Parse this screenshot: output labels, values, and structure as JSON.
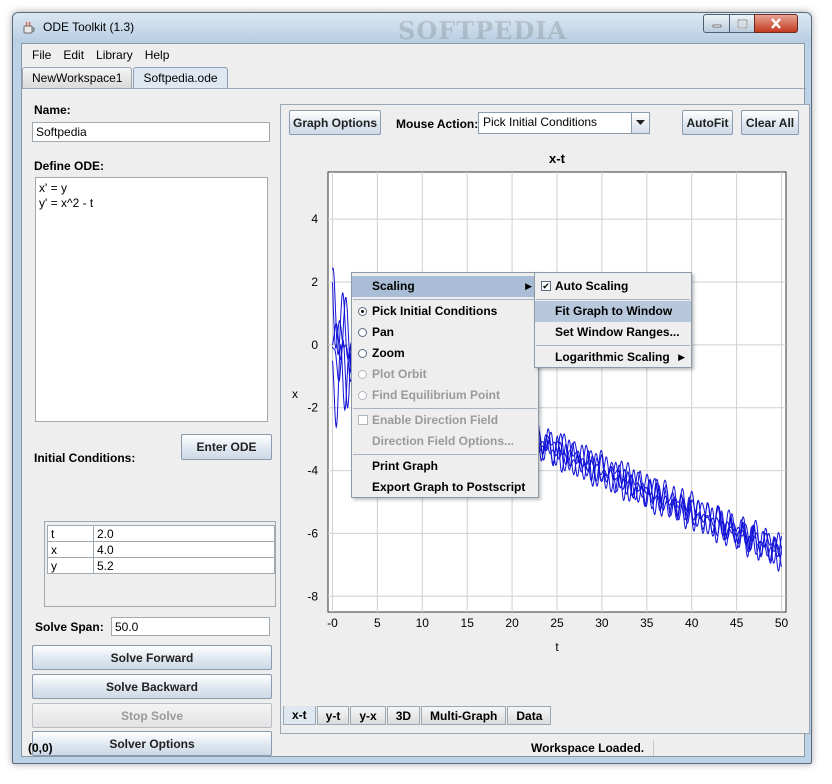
{
  "window": {
    "title": "ODE Toolkit (1.3)",
    "watermark": "SOFTPEDIA"
  },
  "menubar": {
    "items": [
      "File",
      "Edit",
      "Library",
      "Help"
    ]
  },
  "workspace_tabs": [
    "NewWorkspace1",
    "Softpedia.ode"
  ],
  "left_panel": {
    "name_label": "Name:",
    "name_value": "Softpedia",
    "define_label": "Define ODE:",
    "ode_line1": "x' = y",
    "ode_line2": "y' = x^2 - t",
    "ic_label": "Initial Conditions:",
    "enter_ode": "Enter ODE",
    "ic_rows": [
      {
        "var": "t",
        "val": "2.0"
      },
      {
        "var": "x",
        "val": "4.0"
      },
      {
        "var": "y",
        "val": "5.2"
      }
    ],
    "span_label": "Solve Span:",
    "span_value": "50.0",
    "solve_forward": "Solve Forward",
    "solve_backward": "Solve Backward",
    "stop_solve": "Stop Solve",
    "solver_options": "Solver Options"
  },
  "graph_toolbar": {
    "graph_options": "Graph Options",
    "mouse_action_label": "Mouse Action:",
    "mouse_action_value": "Pick Initial Conditions",
    "autofit": "AutoFit",
    "clear_all": "Clear All"
  },
  "chart_data": {
    "type": "line",
    "title": "x-t",
    "xlabel": "t",
    "ylabel": "x",
    "xlim": [
      -0.5,
      50.5
    ],
    "ylim": [
      -8.5,
      5.5
    ],
    "x_ticks": [
      "-0",
      "5",
      "10",
      "15",
      "20",
      "25",
      "30",
      "35",
      "40",
      "45",
      "50"
    ],
    "y_ticks": [
      "4",
      "2",
      "0",
      "-2",
      "-4",
      "-6",
      "-8"
    ],
    "grid": true,
    "line_color": "#1010d8",
    "series_count": 5,
    "description_of_trend": "oscillating curves descending from about 0 near t=0 to about -6.5 at t=50"
  },
  "graph_tabs": [
    "x-t",
    "y-t",
    "y-x",
    "3D",
    "Multi-Graph",
    "Data"
  ],
  "status": {
    "coords": "(0,0)",
    "message": "Workspace Loaded."
  },
  "context_menu": {
    "scaling": "Scaling",
    "items": [
      {
        "label": "Pick Initial Conditions",
        "kind": "radio",
        "selected": true,
        "enabled": true
      },
      {
        "label": "Pan",
        "kind": "radio",
        "selected": false,
        "enabled": true
      },
      {
        "label": "Zoom",
        "kind": "radio",
        "selected": false,
        "enabled": true
      },
      {
        "label": "Plot Orbit",
        "kind": "radio",
        "selected": false,
        "enabled": false
      },
      {
        "label": "Find Equilibrium Point",
        "kind": "radio",
        "selected": false,
        "enabled": false
      }
    ],
    "enable_direction_field": "Enable Direction Field",
    "direction_field_options": "Direction Field Options...",
    "print_graph": "Print Graph",
    "export_graph": "Export Graph to Postscript"
  },
  "scaling_submenu": {
    "auto_scaling": "Auto Scaling",
    "fit_graph": "Fit Graph to Window",
    "set_ranges": "Set Window Ranges...",
    "log_scaling": "Logarithmic Scaling"
  }
}
